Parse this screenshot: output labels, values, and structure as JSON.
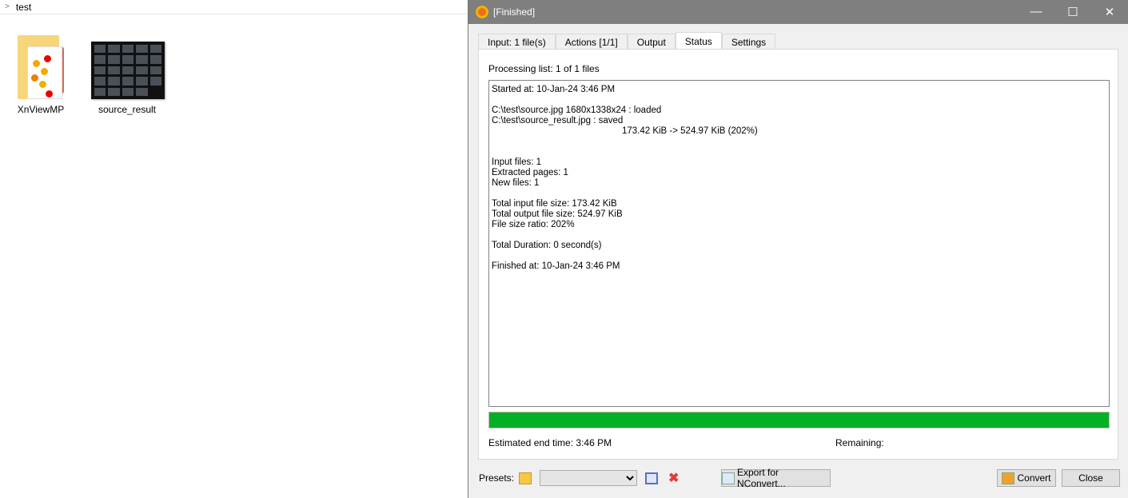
{
  "explorer": {
    "breadcrumb": "test",
    "files": [
      {
        "name": "XnViewMP"
      },
      {
        "name": "source_result"
      }
    ]
  },
  "window": {
    "title": "[Finished]",
    "minimize": "—",
    "maximize": "☐",
    "close": "✕"
  },
  "tabs": [
    "Input: 1 file(s)",
    "Actions [1/1]",
    "Output",
    "Status",
    "Settings"
  ],
  "status": {
    "processing_label": "Processing list:  1 of 1 files",
    "log": "Started at: 10-Jan-24 3:46 PM\n\nC:\\test\\source.jpg 1680x1338x24 : loaded\nC:\\test\\source_result.jpg : saved\n                                                   173.42 KiB -> 524.97 KiB (202%)\n\n\nInput files: 1\nExtracted pages: 1\nNew files: 1\n\nTotal input file size: 173.42 KiB\nTotal output file size: 524.97 KiB\nFile size ratio: 202%\n\nTotal Duration: 0 second(s)\n\nFinished at: 10-Jan-24 3:46 PM",
    "progress_percent": 100,
    "estimated_end": "Estimated end time:  3:46 PM",
    "remaining": "Remaining:"
  },
  "bottom": {
    "presets_label": "Presets:",
    "preset_value": "",
    "export_label": "Export for NConvert...",
    "convert_label": "Convert",
    "close_label": "Close"
  },
  "colors": {
    "progress": "#06b025",
    "titlebar": "#7f7f7f"
  }
}
